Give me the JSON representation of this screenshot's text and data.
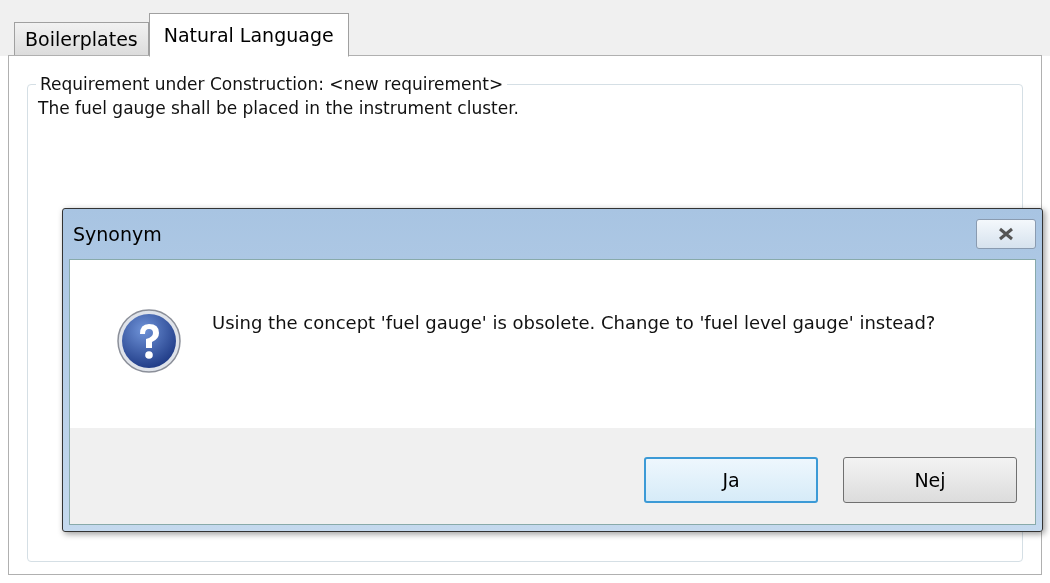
{
  "tabs": [
    {
      "label": "Boilerplates",
      "selected": false
    },
    {
      "label": "Natural Language",
      "selected": true
    }
  ],
  "group": {
    "title": "Requirement under Construction: <new requirement>",
    "text": "The fuel gauge shall be placed in the instrument cluster."
  },
  "dialog": {
    "title": "Synonym",
    "message": "Using the concept 'fuel gauge' is obsolete. Change to 'fuel level gauge' instead?",
    "buttons": [
      {
        "label": "Ja",
        "default": true
      },
      {
        "label": "Nej",
        "default": false
      }
    ]
  }
}
